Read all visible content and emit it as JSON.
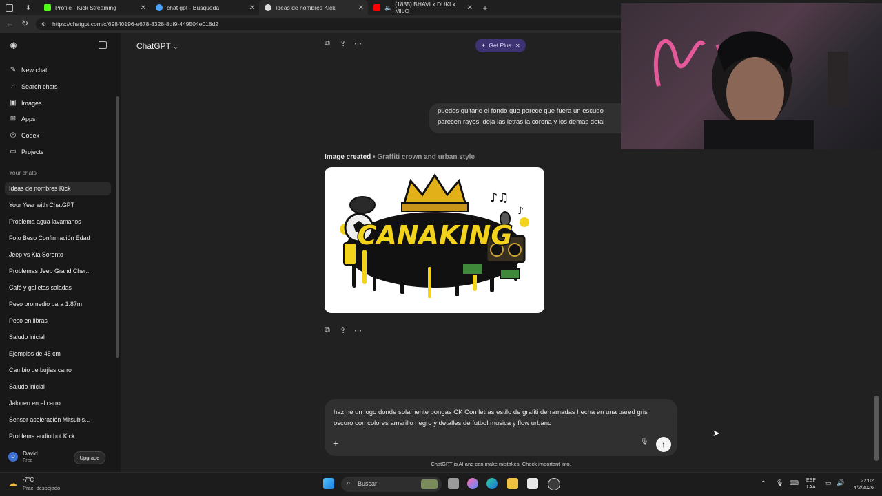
{
  "browser": {
    "tabs": [
      {
        "label": "Profile - Kick Streaming",
        "favicon_color": "#53fc18"
      },
      {
        "label": "chat gpt - Búsqueda",
        "favicon_color": "#4aa3ff"
      },
      {
        "label": "Ideas de nombres Kick",
        "favicon_color": "#dddddd"
      },
      {
        "label": "(1835) BHAVI x DUKI x MILO",
        "favicon_color": "#ff0000"
      }
    ],
    "url": "https://chatgpt.com/c/69840196-e678-8328-8df9-449504e018d2"
  },
  "sidebar": {
    "nav": [
      {
        "label": "New chat",
        "icon": "edit-icon"
      },
      {
        "label": "Search chats",
        "icon": "search-icon"
      },
      {
        "label": "Images",
        "icon": "image-icon"
      },
      {
        "label": "Apps",
        "icon": "apps-icon"
      },
      {
        "label": "Codex",
        "icon": "codex-icon"
      },
      {
        "label": "Projects",
        "icon": "folder-icon"
      }
    ],
    "your_chats_label": "Your chats",
    "chats": [
      "Ideas de nombres Kick",
      "Your Year with ChatGPT",
      "Problema agua lavamanos",
      "Foto Beso Confirmación Edad",
      "Jeep vs Kia Sorento",
      "Problemas Jeep Grand Cher...",
      "Café y galletas saladas",
      "Peso promedio para 1.87m",
      "Peso en libras",
      "Saludo inicial",
      "Ejemplos de 45 cm",
      "Cambio de bujías carro",
      "Saludo inicial",
      "Jaloneo en el carro",
      "Sensor aceleración Mitsubis...",
      "Problema audio bot Kick"
    ],
    "user": {
      "initial": "D",
      "name": "David",
      "plan": "Free",
      "upgrade_label": "Upgrade"
    }
  },
  "main": {
    "model_label": "ChatGPT",
    "get_plus_label": "Get Plus",
    "user_message_line1": "puedes quitarle el fondo que parece que fuera un escudo",
    "user_message_line2": "parecen rayos, deja las letras la corona y los demas detal",
    "image_caption_bold": "Image created",
    "image_caption_sub": "• Graffiti crown and urban style",
    "image_logo_text": "CANAKING",
    "composer_text": "hazme un logo donde solamente pongas CK Con letras estilo de grafiti derramadas hecha en una pared gris oscuro con colores amarillo negro y detalles de futbol musica y flow urbano",
    "disclaimer": "ChatGPT is AI and can make mistakes. Check important info."
  },
  "taskbar": {
    "temperature": "-7°C",
    "weather": "Prac. despejado",
    "search_label": "Buscar",
    "lang_line1": "ESP",
    "lang_line2": "LAA",
    "time": "22:02",
    "date": "4/2/2026"
  },
  "colors": {
    "accent_plus": "#3d3272",
    "logo_yellow": "#f2d21a"
  }
}
